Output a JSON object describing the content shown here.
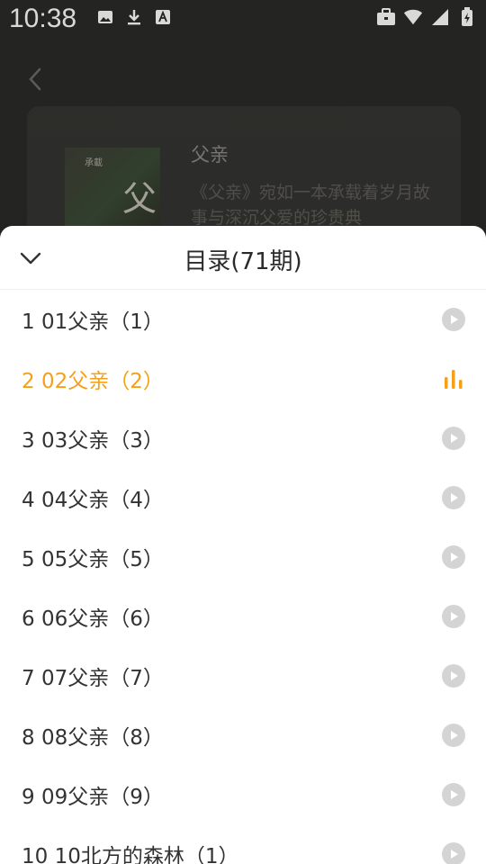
{
  "status_bar": {
    "time": "10:38",
    "left_icons": [
      "image-icon",
      "download-icon",
      "text-a-icon"
    ],
    "right_icons": [
      "briefcase-icon",
      "wifi-icon",
      "signal-icon",
      "battery-icon"
    ]
  },
  "album": {
    "title": "父亲",
    "description": "《父亲》宛如一本承载着岁月故事与深沉父爱的珍贵典",
    "cover_char": "父",
    "cover_label": "承載"
  },
  "sheet": {
    "title": "目录(71期)",
    "accent_color": "#f5a01a",
    "items": [
      {
        "label": "1 01父亲（1）",
        "state": "play"
      },
      {
        "label": "2 02父亲（2）",
        "state": "playing"
      },
      {
        "label": "3 03父亲（3）",
        "state": "play"
      },
      {
        "label": "4 04父亲（4）",
        "state": "play"
      },
      {
        "label": "5 05父亲（5）",
        "state": "play"
      },
      {
        "label": "6 06父亲（6）",
        "state": "play"
      },
      {
        "label": "7 07父亲（7）",
        "state": "play"
      },
      {
        "label": "8 08父亲（8）",
        "state": "play"
      },
      {
        "label": "9 09父亲（9）",
        "state": "play"
      },
      {
        "label": "10 10北方的森林（1）",
        "state": "play"
      }
    ]
  }
}
